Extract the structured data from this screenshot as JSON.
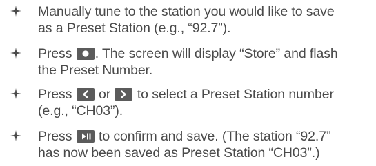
{
  "steps": [
    {
      "lines": [
        "Manually tune to the station you would like to save",
        "as a Preset Station (e.g., “92.7”)."
      ]
    },
    {
      "pre": "Press",
      "button_icon": "record-circle-icon",
      "post": ". The screen will display “Store” and flash",
      "line2": "the Preset Number."
    },
    {
      "pre": "Press",
      "button_icon_a": "previous-arrow-icon",
      "mid": "or",
      "button_icon_b": "next-arrow-icon",
      "post": "to select a Preset Station number",
      "line2": "(e.g., “CH03”)."
    },
    {
      "pre": "Press",
      "button_icon": "play-pause-icon",
      "post": "to confirm and save. (The station “92.7”",
      "line2": "has now been saved as Preset Station “CH03”.)"
    }
  ],
  "colors": {
    "text": "#4a4a4a",
    "button": "#5b5b5b",
    "button_glyph": "#ffffff"
  }
}
